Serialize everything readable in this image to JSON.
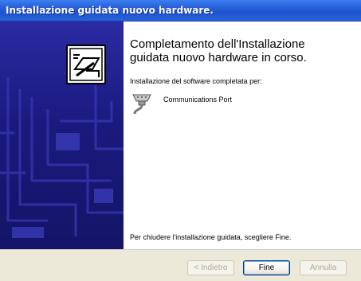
{
  "window": {
    "title": "Installazione guidata nuovo hardware."
  },
  "content": {
    "heading_line1": "Completamento dell'Installazione",
    "heading_line2": "guidata nuovo hardware in corso.",
    "subtext": "Installazione del software completata per:",
    "device_name": "Communications Port",
    "device_icon": "serial-port-icon",
    "footer_text": "Per chiudere l'installazione guidata, scegliere Fine."
  },
  "buttons": {
    "back_label": "< Indietro",
    "finish_label": "Fine",
    "cancel_label": "Annulla"
  },
  "colors": {
    "titlebar": "#2a64dc",
    "sidebar": "#1a1a7e",
    "dialog_bg": "#ece9d8"
  }
}
